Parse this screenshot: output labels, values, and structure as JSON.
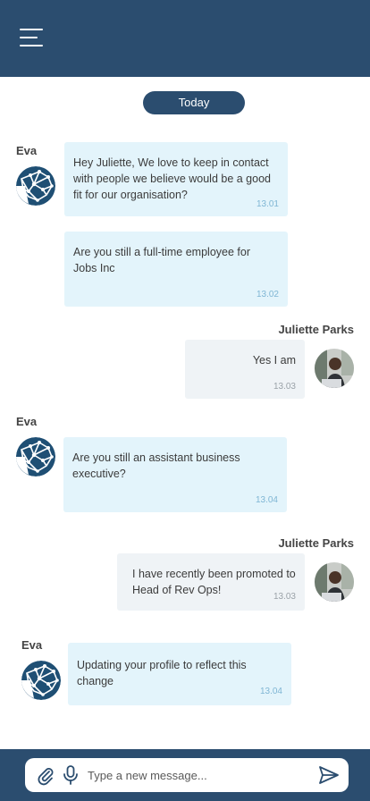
{
  "date_divider": "Today",
  "messages": [
    {
      "sender": "Eva",
      "text_lines": [
        "Hey Juliette, We love to keep in contact",
        "with people we believe would be a good",
        "fit for our organisation?"
      ],
      "time": "13.01"
    },
    {
      "text_lines": [
        "Are you still a full-time employee for",
        "Jobs Inc"
      ],
      "time": "13.02"
    },
    {
      "sender": "Juliette Parks",
      "text_lines": [
        "Yes I am"
      ],
      "time": "13.03"
    },
    {
      "sender": "Eva",
      "text_lines": [
        "Are you still an assistant business",
        "executive?"
      ],
      "time": "13.04"
    },
    {
      "sender": "Juliette Parks",
      "text_lines": [
        "I have recently been promoted to",
        "Head of Rev Ops!"
      ],
      "time": "13.03"
    },
    {
      "sender": "Eva",
      "text_lines": [
        "Updating your profile to reflect this",
        "change"
      ],
      "time": "13.04"
    }
  ],
  "composer": {
    "placeholder": "Type a new message..."
  },
  "icons": {
    "menu": "hamburger-icon",
    "attach": "paperclip-icon",
    "mic": "microphone-icon",
    "send": "send-icon"
  },
  "colors": {
    "brand": "#2b4d6f",
    "incoming_bubble": "#e3f4fb",
    "outgoing_bubble": "#eff3f6"
  }
}
